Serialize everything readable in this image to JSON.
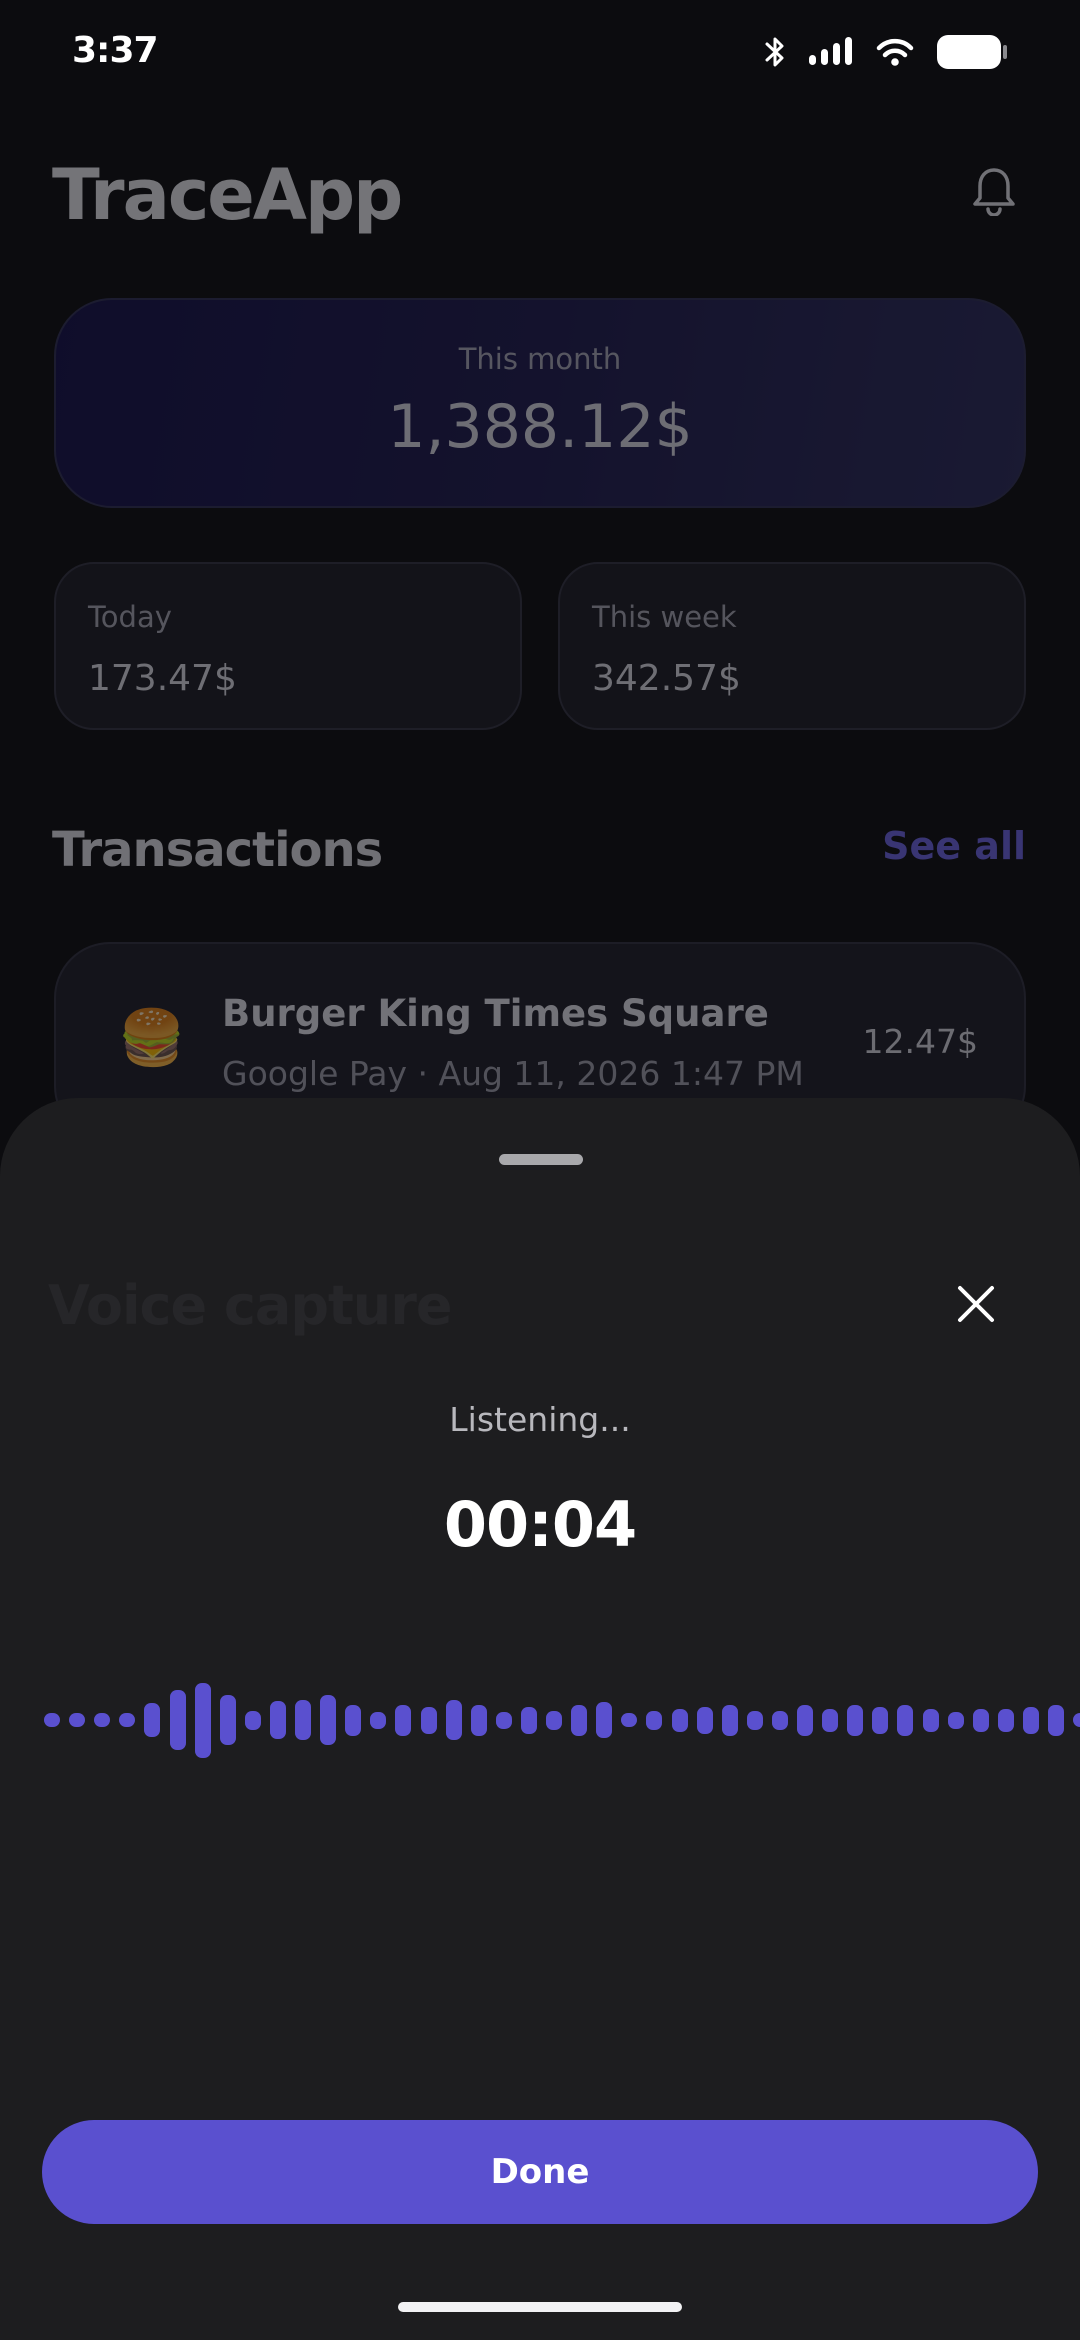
{
  "status_bar": {
    "time": "3:37"
  },
  "header": {
    "app_title": "TraceApp",
    "bell_icon": "bell-icon"
  },
  "summary": {
    "month_label": "This month",
    "month_value": "1,388.12$",
    "today_label": "Today",
    "today_value": "173.47$",
    "week_label": "This week",
    "week_value": "342.57$"
  },
  "transactions": {
    "title": "Transactions",
    "see_all": "See all",
    "items": [
      {
        "icon": "🍔",
        "name": "Burger King Times Square",
        "subtitle": "Google Pay · Aug 11, 2026 1:47 PM",
        "amount": "12.47$"
      }
    ]
  },
  "voice_sheet": {
    "title": "Voice capture",
    "status": "Listening...",
    "timer": "00:04",
    "done_label": "Done",
    "accent_color": "#5a50cf",
    "waveform_levels": [
      0.14,
      0.14,
      0.14,
      0.14,
      0.35,
      0.62,
      0.78,
      0.52,
      0.2,
      0.4,
      0.42,
      0.52,
      0.32,
      0.18,
      0.32,
      0.28,
      0.42,
      0.32,
      0.18,
      0.28,
      0.2,
      0.32,
      0.38,
      0.14,
      0.2,
      0.24,
      0.28,
      0.32,
      0.2,
      0.2,
      0.32,
      0.24,
      0.32,
      0.28,
      0.32,
      0.24,
      0.18,
      0.24,
      0.24,
      0.28,
      0.32,
      0.14
    ]
  }
}
